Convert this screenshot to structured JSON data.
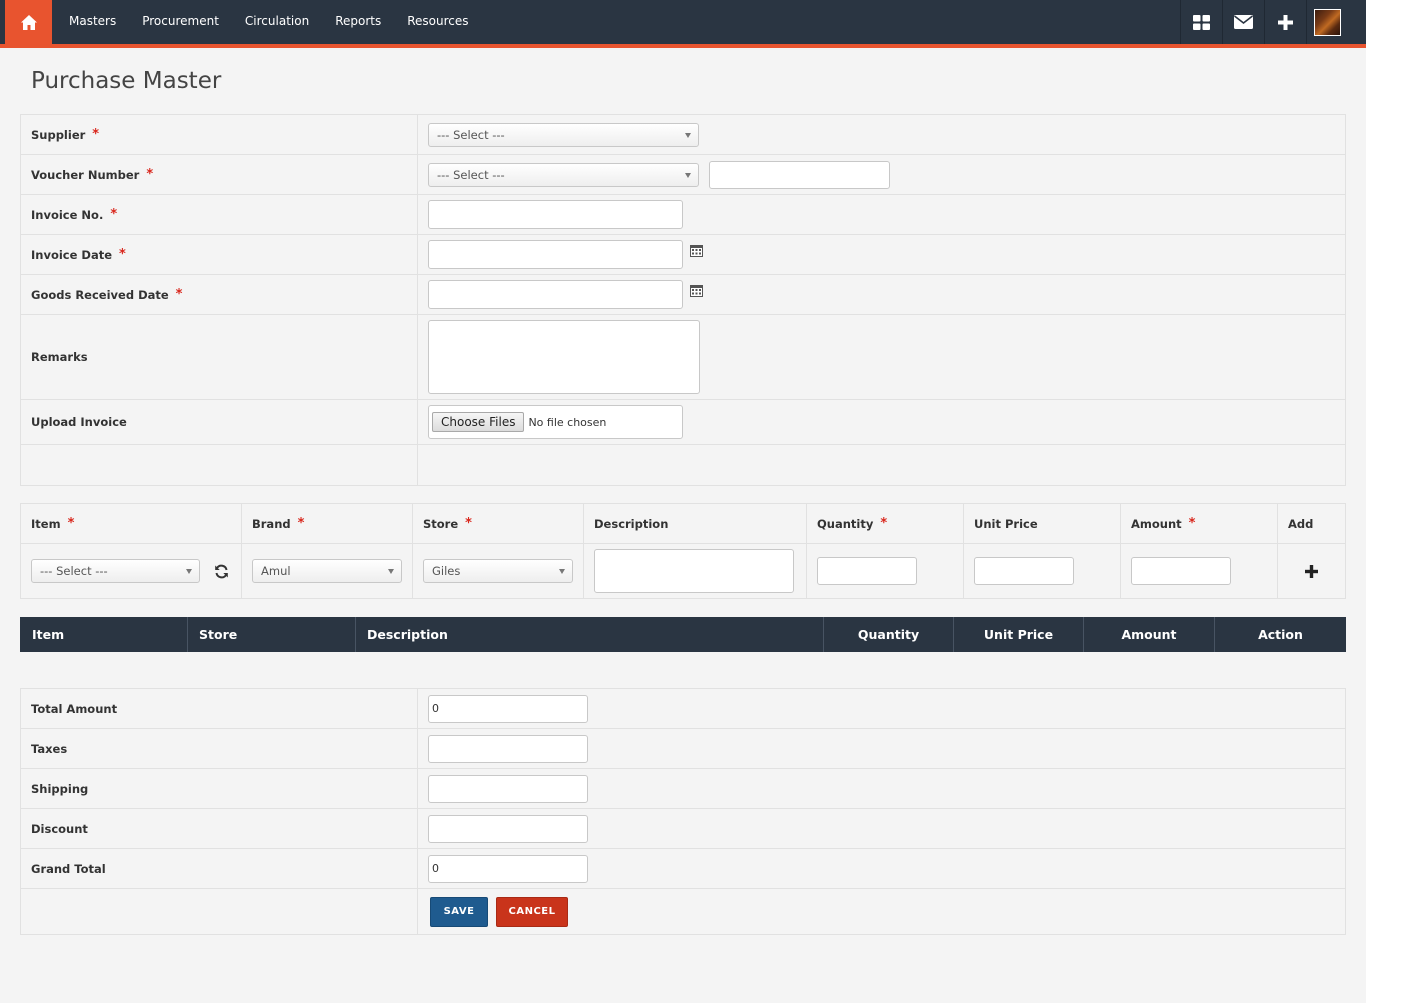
{
  "nav": {
    "items": [
      "Masters",
      "Procurement",
      "Circulation",
      "Reports",
      "Resources"
    ],
    "right_icons": [
      "grid-icon",
      "envelope-icon",
      "plus-icon",
      "avatar"
    ]
  },
  "page": {
    "title": "Purchase Master"
  },
  "form": {
    "supplier": {
      "label": "Supplier",
      "required": "*",
      "select_value": "--- Select ---"
    },
    "voucher": {
      "label": "Voucher Number",
      "required": "*",
      "select_value": "--- Select ---",
      "input_value": ""
    },
    "invoice_no": {
      "label": "Invoice No.",
      "required": "*",
      "value": ""
    },
    "invoice_date": {
      "label": "Invoice Date",
      "required": "*",
      "value": ""
    },
    "goods_received_date": {
      "label": "Goods Received Date",
      "required": "*",
      "value": ""
    },
    "remarks": {
      "label": "Remarks",
      "value": ""
    },
    "upload": {
      "label": "Upload Invoice",
      "button": "Choose Files",
      "status": "No file chosen"
    }
  },
  "item_entry": {
    "headers": {
      "item": "Item",
      "brand": "Brand",
      "store": "Store",
      "description": "Description",
      "quantity": "Quantity",
      "unit_price": "Unit Price",
      "amount": "Amount",
      "add": "Add"
    },
    "required": "*",
    "item_select": "--- Select ---",
    "brand_select": "Amul",
    "store_select": "Giles"
  },
  "grid": {
    "columns": [
      "Item",
      "Store",
      "Description",
      "Quantity",
      "Unit Price",
      "Amount",
      "Action"
    ]
  },
  "totals": {
    "total_amount": {
      "label": "Total Amount",
      "value": "0"
    },
    "taxes": {
      "label": "Taxes",
      "value": ""
    },
    "shipping": {
      "label": "Shipping",
      "value": ""
    },
    "discount": {
      "label": "Discount",
      "value": ""
    },
    "grand_total": {
      "label": "Grand Total",
      "value": "0"
    }
  },
  "actions": {
    "save": "SAVE",
    "cancel": "CANCEL"
  },
  "colors": {
    "nav_bg": "#2a3542",
    "accent": "#e8542f",
    "save": "#1f5b8f",
    "cancel": "#c9341b",
    "required": "#d9261c"
  }
}
